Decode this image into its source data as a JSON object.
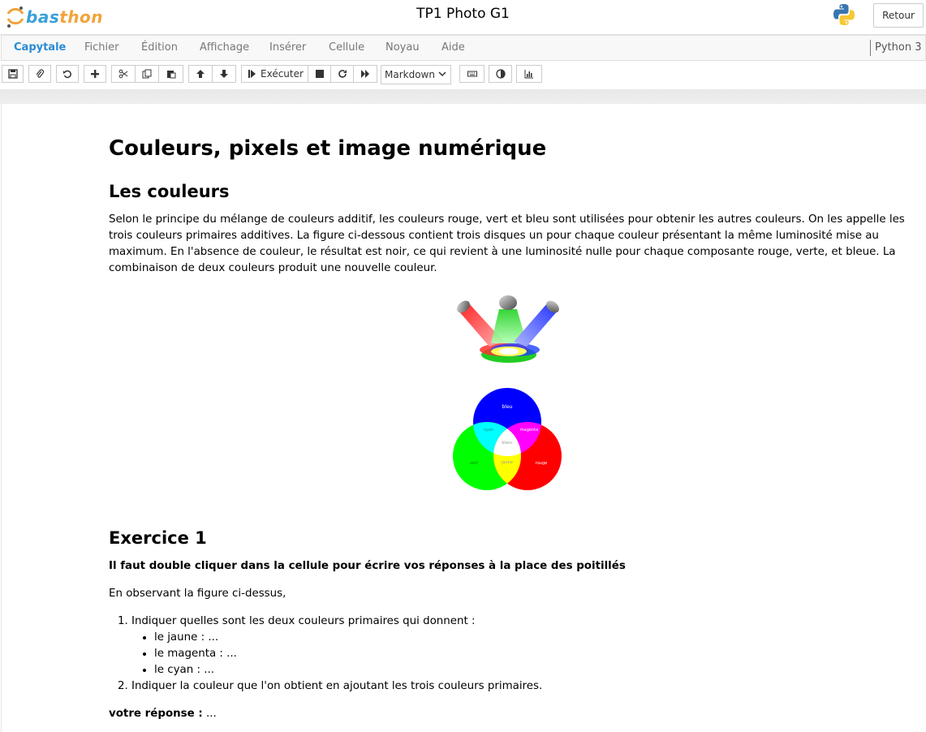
{
  "header": {
    "logo_text_1": "bas",
    "logo_text_2": "thon",
    "title": "TP1 Photo G1",
    "retour_label": "Retour"
  },
  "menu": {
    "items": [
      "Capytale",
      "Fichier",
      "Édition",
      "Affichage",
      "Insérer",
      "Cellule",
      "Noyau",
      "Aide"
    ],
    "kernel": "Python 3"
  },
  "toolbar": {
    "run_label": "Exécuter",
    "cell_type": "Markdown",
    "icons": [
      "save-icon",
      "paperclip-icon",
      "undo-icon",
      "plus-icon",
      "cut-icon",
      "copy-icon",
      "paste-icon",
      "arrow-up-icon",
      "arrow-down-icon",
      "run-icon",
      "stop-icon",
      "restart-icon",
      "fast-forward-icon",
      "keyboard-icon",
      "contrast-icon",
      "chart-icon"
    ]
  },
  "doc": {
    "h1": "Couleurs, pixels et image numérique",
    "h2_colors": "Les couleurs",
    "para1": "Selon le principe du mélange de couleurs additif, les couleurs rouge, vert et bleu sont utilisées pour obtenir les autres couleurs. On les appelle les trois couleurs primaires additives. La figure ci-dessous contient trois disques un pour chaque couleur présentant la même luminosité mise au maximum. En l'absence de couleur, le résultat est noir, ce qui revient à une luminosité nulle pour chaque composante rouge, verte, et bleue. La combinaison de deux couleurs produit une nouvelle couleur.",
    "venn": {
      "bleu": "bleu",
      "cyan": "cyan",
      "magenta": "magenta",
      "blanc": "blanc",
      "vert": "vert",
      "jaune": "jaune",
      "rouge": "rouge"
    },
    "h2_ex": "Exercice 1",
    "instruction": "Il faut double cliquer dans la cellule pour écrire vos réponses à la place des poitillés",
    "observe": "En observant la figure ci-dessus,",
    "q1": "Indiquer quelles sont les deux couleurs primaires qui donnent :",
    "q1_items": [
      "le jaune : ...",
      "le magenta : ...",
      "le cyan : ..."
    ],
    "q2": "Indiquer la couleur que l'on obtient en ajoutant les trois couleurs primaires.",
    "answer_label": "votre réponse :",
    "answer_value": " ..."
  },
  "colors": {
    "accent": "#2a8bd4",
    "logo_orange": "#f2a33a",
    "logo_blue": "#3aa0d8"
  }
}
